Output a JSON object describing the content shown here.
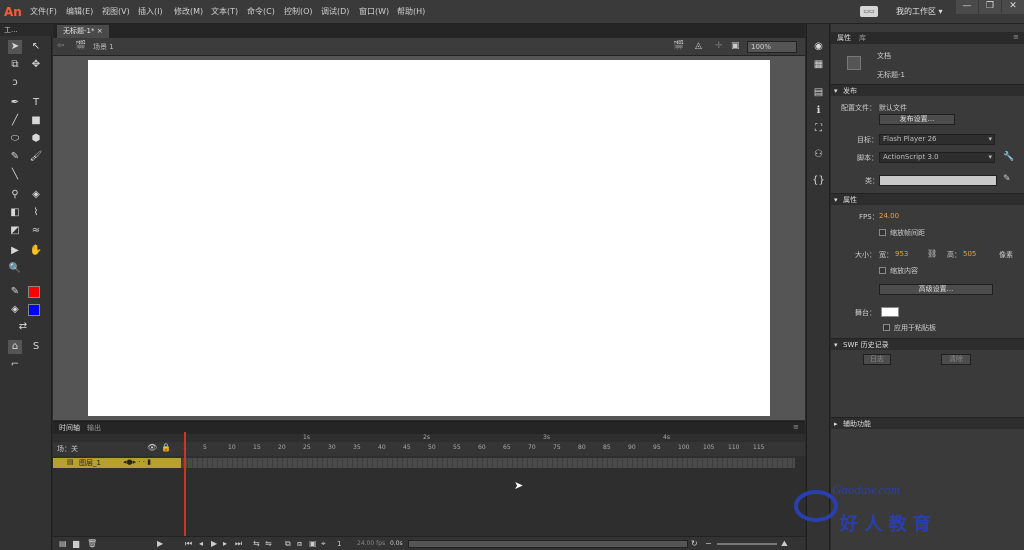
{
  "app": {
    "logo": "An"
  },
  "menu": [
    "文件(F)",
    "编辑(E)",
    "视图(V)",
    "插入(I)",
    "修改(M)",
    "文本(T)",
    "命令(C)",
    "控制(O)",
    "调试(D)",
    "窗口(W)",
    "帮助(H)"
  ],
  "workspace": {
    "label": "我的工作区 ▾",
    "switch": "▭▭"
  },
  "window_buttons": [
    "—",
    "❐",
    "✕"
  ],
  "tools_panel": {
    "title": "工..."
  },
  "document": {
    "tab": "无标题-1* ×",
    "scene": "场景 1",
    "zoom": "100%"
  },
  "properties": {
    "tabs": [
      "属性",
      "库"
    ],
    "doc_type": "文档",
    "doc_name": "无标题-1",
    "sections": {
      "publish": "发布",
      "properties": "属性",
      "swf_history": "SWF 历史记录",
      "accessibility": "辅助功能"
    },
    "profile_label": "配置文件：",
    "profile_value": "默认文件",
    "publish_settings": "发布设置...",
    "target_label": "目标：",
    "target_value": "Flash Player 26",
    "script_label": "脚本：",
    "script_value": "ActionScript 3.0",
    "class_label": "类：",
    "fps_label": "FPS：",
    "fps_value": "24.00",
    "scale_spans": "缩放帧间距",
    "size_label": "大小：",
    "width_label": "宽：",
    "width_value": "953",
    "height_label": "高：",
    "height_value": "505",
    "unit": "像素",
    "scale_content": "缩放内容",
    "advanced_settings": "高级设置...",
    "stage_label": "舞台：",
    "apply_pasteboard": "应用于粘贴板",
    "history_log": "日志",
    "history_clear": "清除"
  },
  "timeline": {
    "tabs": [
      "时间轴",
      "输出"
    ],
    "scene_label": "图层 1",
    "parent_label": "场：关",
    "layer_name": "图层_1",
    "seconds": [
      "1s",
      "2s",
      "3s",
      "4s"
    ],
    "ticks": [
      "1",
      "5",
      "10",
      "15",
      "20",
      "25",
      "30",
      "35",
      "40",
      "45",
      "50",
      "55",
      "60",
      "65",
      "70",
      "75",
      "80",
      "85",
      "90",
      "95",
      "100",
      "105",
      "110",
      "115"
    ],
    "frame_num": "1",
    "fps": "24.00 fps",
    "time": "0.0s"
  },
  "watermark": {
    "brand": "Gaodaw.com",
    "text": "好 人 教 育"
  },
  "colors": {
    "stroke": "#ff0000",
    "fill": "#0000ff",
    "accent": "#f0a030"
  }
}
